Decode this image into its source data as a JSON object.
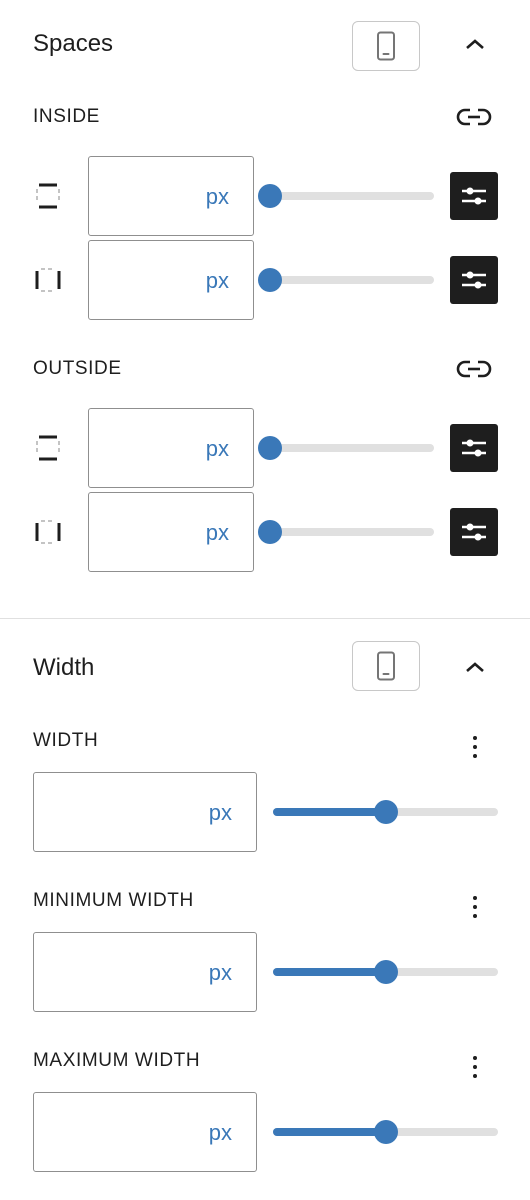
{
  "spaces": {
    "title": "Spaces",
    "device_icon": "mobile-device-icon",
    "collapse_icon": "chevron-up-icon",
    "inside": {
      "label": "INSIDE",
      "link_icon": "unlink-icon",
      "rows": [
        {
          "side": "top-bottom",
          "value": "",
          "unit": "px",
          "slider_fraction": 0
        },
        {
          "side": "left-right",
          "value": "",
          "unit": "px",
          "slider_fraction": 0
        }
      ]
    },
    "outside": {
      "label": "OUTSIDE",
      "link_icon": "unlink-icon",
      "rows": [
        {
          "side": "top-bottom",
          "value": "",
          "unit": "px",
          "slider_fraction": 0
        },
        {
          "side": "left-right",
          "value": "",
          "unit": "px",
          "slider_fraction": 0
        }
      ]
    }
  },
  "width": {
    "title": "Width",
    "device_icon": "mobile-device-icon",
    "collapse_icon": "chevron-up-icon",
    "fields": [
      {
        "label": "WIDTH",
        "value": "",
        "unit": "px",
        "slider_fraction": 0.5
      },
      {
        "label": "MINIMUM WIDTH",
        "value": "",
        "unit": "px",
        "slider_fraction": 0.5
      },
      {
        "label": "MAXIMUM WIDTH",
        "value": "",
        "unit": "px",
        "slider_fraction": 0.5
      }
    ]
  },
  "colors": {
    "accent": "#3a78b8",
    "text": "#1e1e1e",
    "border": "#8f8f8f",
    "track": "#e0e0e0"
  }
}
